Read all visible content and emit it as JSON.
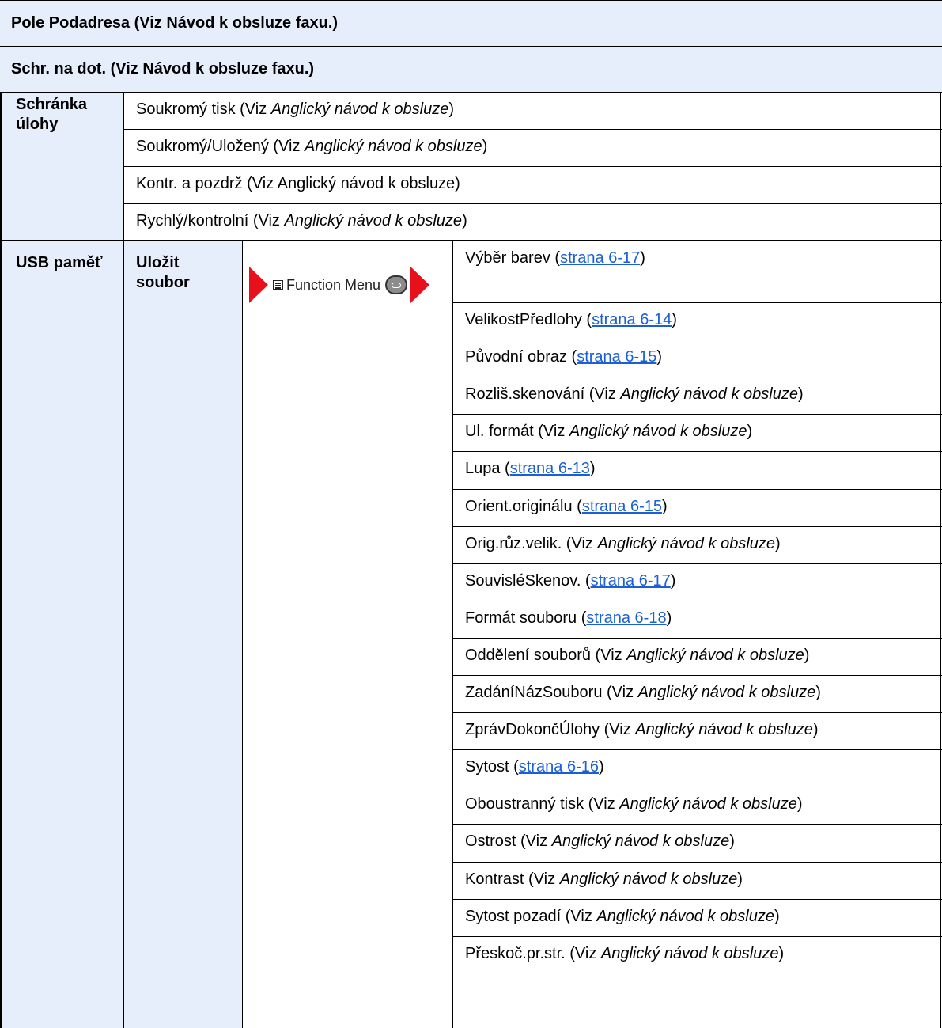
{
  "header_rows": [
    "Pole Podadresa (Viz Návod k obsluze faxu.)",
    "Schr. na dot. (Viz Návod k obsluze faxu.)"
  ],
  "job_box": {
    "label": "Schránka úlohy",
    "items": [
      {
        "text": "Soukromý tisk (Viz ",
        "ref": "Anglický návod k obsluze",
        "suffix": ")"
      },
      {
        "text": "Soukromý/Uložený (Viz ",
        "ref": "Anglický návod k obsluze",
        "suffix": ")"
      },
      {
        "text": "Kontr. a pozdrž (Viz Anglický návod k obsluze)",
        "ref": "",
        "suffix": ""
      },
      {
        "text": "Rychlý/kontrolní (Viz ",
        "ref": "Anglický návod k obsluze",
        "suffix": ")"
      }
    ]
  },
  "usb": {
    "label": "USB paměť",
    "sub_label": "Uložit soubor",
    "function_menu_label": "Function Menu",
    "items": [
      {
        "text": "Výběr barev (",
        "link": "strana 6-17",
        "suffix": ")"
      },
      {
        "text": "VelikostPředlohy (",
        "link": "strana 6-14",
        "suffix": ")"
      },
      {
        "text": "Původní obraz (",
        "link": "strana 6-15",
        "suffix": ")"
      },
      {
        "text": "Rozliš.skenování (Viz ",
        "ref": "Anglický návod k obsluze",
        "suffix": ")"
      },
      {
        "text": "Ul. formát (Viz ",
        "ref": "Anglický návod k obsluze",
        "suffix": ")"
      },
      {
        "text": "Lupa (",
        "link": "strana 6-13",
        "suffix": ")"
      },
      {
        "text": "Orient.originálu (",
        "link": "strana 6-15",
        "suffix": ")"
      },
      {
        "text": "Orig.růz.velik. (Viz ",
        "ref": "Anglický návod k obsluze",
        "suffix": ")"
      },
      {
        "text": "SouvisléSkenov. (",
        "link": "strana 6-17",
        "suffix": ")"
      },
      {
        "text": "Formát souboru (",
        "link": "strana 6-18",
        "suffix": ")"
      },
      {
        "text": "Oddělení souborů (Viz ",
        "ref": "Anglický návod k obsluze",
        "suffix": ")"
      },
      {
        "text": "ZadáníNázSouboru (Viz ",
        "ref": "Anglický návod k obsluze",
        "suffix": ")"
      },
      {
        "text": "ZprávDokončÚlohy (Viz ",
        "ref": "Anglický návod k obsluze",
        "suffix": ")"
      },
      {
        "text": "Sytost (",
        "link": "strana 6-16",
        "suffix": ")"
      },
      {
        "text": "Oboustranný tisk (Viz ",
        "ref": "Anglický návod k obsluze",
        "suffix": ")"
      },
      {
        "text": "Ostrost (Viz ",
        "ref": "Anglický návod k obsluze",
        "suffix": ")"
      },
      {
        "text": "Kontrast (Viz ",
        "ref": "Anglický návod k obsluze",
        "suffix": ")"
      },
      {
        "text": "Sytost pozadí (Viz ",
        "ref": "Anglický návod k obsluze",
        "suffix": ")"
      },
      {
        "text": "Přeskoč.pr.str. (Viz ",
        "ref": "Anglický návod k obsluze",
        "suffix": ")"
      }
    ]
  },
  "colors": {
    "header_bg": "#e7eefb",
    "link": "#1a5fd6",
    "arrow": "#e8101a"
  }
}
